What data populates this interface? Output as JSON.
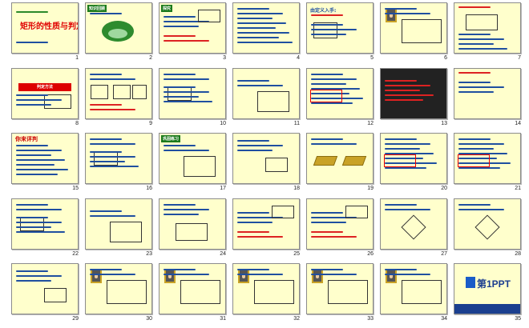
{
  "slides": [
    {
      "number": "1",
      "variant": "title",
      "title": "矩形的性质与判定"
    },
    {
      "number": "2",
      "variant": "oval",
      "header": "知识回顾"
    },
    {
      "number": "3",
      "variant": "para",
      "header": "探究"
    },
    {
      "number": "4",
      "variant": "list"
    },
    {
      "number": "5",
      "variant": "intro",
      "title": "由定义入手:"
    },
    {
      "number": "6",
      "variant": "picture"
    },
    {
      "number": "7",
      "variant": "redtitle"
    },
    {
      "number": "8",
      "variant": "banner",
      "header": "判定方法"
    },
    {
      "number": "9",
      "variant": "compare"
    },
    {
      "number": "10",
      "variant": "proof"
    },
    {
      "number": "11",
      "variant": "proof2"
    },
    {
      "number": "12",
      "variant": "steps"
    },
    {
      "number": "13",
      "variant": "dark"
    },
    {
      "number": "14",
      "variant": "question"
    },
    {
      "number": "15",
      "variant": "quiz",
      "title": "你来评判"
    },
    {
      "number": "16",
      "variant": "proof"
    },
    {
      "number": "17",
      "variant": "proof2",
      "header": "巩固练习"
    },
    {
      "number": "18",
      "variant": "lines"
    },
    {
      "number": "19",
      "variant": "segments"
    },
    {
      "number": "20",
      "variant": "steps"
    },
    {
      "number": "21",
      "variant": "steps"
    },
    {
      "number": "22",
      "variant": "proof"
    },
    {
      "number": "23",
      "variant": "proof2"
    },
    {
      "number": "24",
      "variant": "figure"
    },
    {
      "number": "25",
      "variant": "para"
    },
    {
      "number": "26",
      "variant": "para"
    },
    {
      "number": "27",
      "variant": "rhombus"
    },
    {
      "number": "28",
      "variant": "rhombus"
    },
    {
      "number": "29",
      "variant": "lines"
    },
    {
      "number": "30",
      "variant": "picture"
    },
    {
      "number": "31",
      "variant": "picture"
    },
    {
      "number": "32",
      "variant": "picture"
    },
    {
      "number": "33",
      "variant": "picture"
    },
    {
      "number": "34",
      "variant": "picture"
    },
    {
      "number": "35",
      "variant": "logo",
      "title": "第1PPT"
    }
  ],
  "colors": {
    "slide_bg": "#ffffcc",
    "title_red": "#cc0000",
    "text_blue": "#1f4fa0",
    "banner_red": "#d00000",
    "dark_bg": "#222222"
  }
}
